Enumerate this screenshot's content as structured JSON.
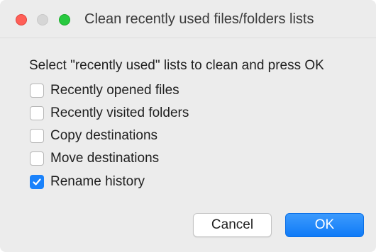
{
  "window": {
    "title": "Clean recently used files/folders lists"
  },
  "dialog": {
    "prompt": "Select \"recently used\" lists to clean and press OK",
    "options": [
      {
        "label": "Recently opened files",
        "checked": false
      },
      {
        "label": "Recently visited folders",
        "checked": false
      },
      {
        "label": "Copy destinations",
        "checked": false
      },
      {
        "label": "Move destinations",
        "checked": false
      },
      {
        "label": "Rename history",
        "checked": true
      }
    ]
  },
  "buttons": {
    "cancel_label": "Cancel",
    "ok_label": "OK"
  },
  "colors": {
    "accent": "#1a82fb",
    "close": "#ff5f57",
    "minimize_disabled": "#d6d6d6",
    "zoom": "#28c940"
  }
}
